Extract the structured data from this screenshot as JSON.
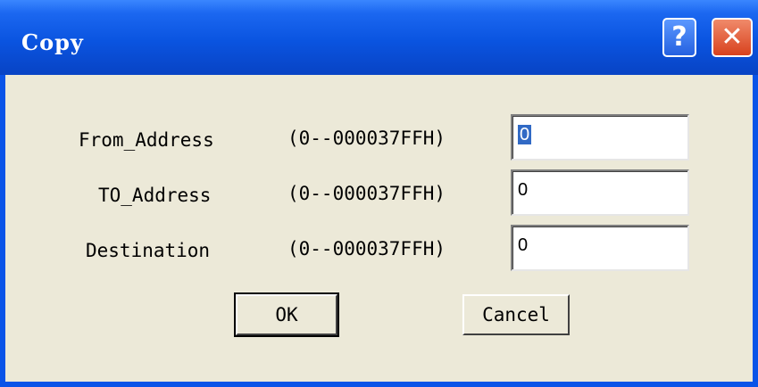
{
  "window": {
    "title": "Copy"
  },
  "titlebar_buttons": {
    "help": "?",
    "close": "✕"
  },
  "fields": [
    {
      "label": "From_Address",
      "range": "(0--000037FFH)",
      "value": "0",
      "selected": true
    },
    {
      "label": "TO_Address",
      "range": "(0--000037FFH)",
      "value": "0",
      "selected": false
    },
    {
      "label": "Destination",
      "range": "(0--000037FFH)",
      "value": "0",
      "selected": false
    }
  ],
  "buttons": {
    "ok": "OK",
    "cancel": "Cancel"
  },
  "colors": {
    "titlebar": "#0a54e0",
    "client": "#ece9d8",
    "selection": "#316ac5"
  }
}
